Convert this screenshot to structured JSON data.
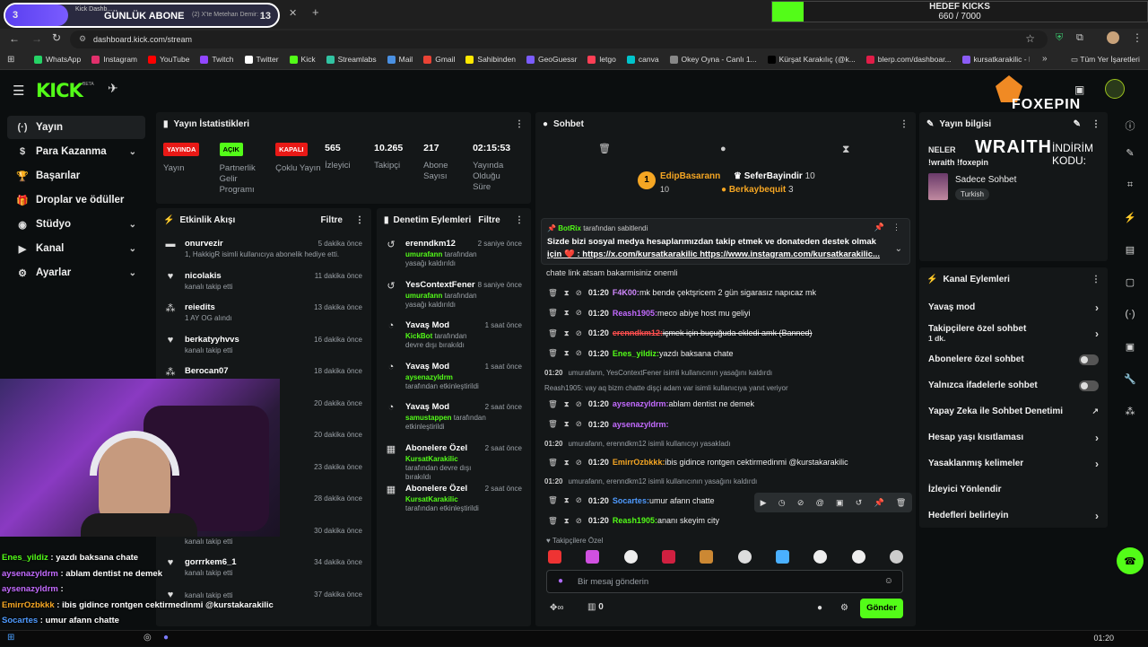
{
  "overlay": {
    "sub_goal_count": "3",
    "sub_goal_label": "GÜNLÜK ABONE",
    "sub_goal_target": "13",
    "kicks_goal_label": "HEDEF KICKS",
    "kicks_goal_value": "660 / 7000",
    "brand": "FOXEPIN",
    "promo_text": "WRAITH",
    "promo_code_label": "İNDİRİM KODU:",
    "promo_code_value": "!wraith !foxepin"
  },
  "browser": {
    "tabs": [
      {
        "label": "Kick Dashb..."
      },
      {
        "label": "(2) X'te Metehan Demir: ..."
      }
    ],
    "url": "dashboard.kick.com/stream",
    "bookmarks": [
      {
        "label": "WhatsApp",
        "color": "#25d366"
      },
      {
        "label": "Instagram",
        "color": "#e1306c"
      },
      {
        "label": "YouTube",
        "color": "#ff0000"
      },
      {
        "label": "Twitch",
        "color": "#9146ff"
      },
      {
        "label": "Twitter",
        "color": "#ffffff"
      },
      {
        "label": "Kick",
        "color": "#53fc18"
      },
      {
        "label": "Streamlabs",
        "color": "#31c3a2"
      },
      {
        "label": "Mail",
        "color": "#4a90e2"
      },
      {
        "label": "Gmail",
        "color": "#ea4335"
      },
      {
        "label": "Sahibinden",
        "color": "#ffe800"
      },
      {
        "label": "GeoGuessr",
        "color": "#7b5cff"
      },
      {
        "label": "letgo",
        "color": "#ff3f55"
      },
      {
        "label": "canva",
        "color": "#00c4cc"
      },
      {
        "label": "Okey Oyna - Canlı 1...",
        "color": "#888888"
      },
      {
        "label": "Kürşat Karakılıç (@k...",
        "color": "#000000"
      },
      {
        "label": "blerp.com/dashboar...",
        "color": "#e11d48"
      },
      {
        "label": "kursatkarakilic - Kic...",
        "color": "#8b5cf6"
      }
    ],
    "all_bookmarks": "Tüm Yer İşaretleri"
  },
  "nav": {
    "items": [
      {
        "label": "Yayın",
        "icon": "(·)",
        "chev": ""
      },
      {
        "label": "Para Kazanma",
        "icon": "$",
        "chev": "⌄"
      },
      {
        "label": "Başarılar",
        "icon": "🏆",
        "chev": ""
      },
      {
        "label": "Droplar ve ödüller",
        "icon": "🎁",
        "chev": ""
      },
      {
        "label": "Stüdyo",
        "icon": "◉",
        "chev": "⌄"
      },
      {
        "label": "Kanal",
        "icon": "▶",
        "chev": "⌄"
      },
      {
        "label": "Ayarlar",
        "icon": "⚙",
        "chev": "⌄"
      }
    ]
  },
  "stats": {
    "title": "Yayın İstatistikleri",
    "items": [
      {
        "badge": "YAYINDA",
        "badge_color": "#e91916",
        "label": "Yayın"
      },
      {
        "badge": "AÇIK",
        "badge_color": "#53fc18",
        "label": "Partnerlik Gelir Programı"
      },
      {
        "badge": "KAPALI",
        "badge_color": "#e91916",
        "label": "Çoklu Yayın"
      },
      {
        "value": "565",
        "label": "İzleyici"
      },
      {
        "value": "10.265",
        "label": "Takipçi"
      },
      {
        "value": "217",
        "label": "Abone Sayısı"
      },
      {
        "value": "02:15:53",
        "label": "Yayında Olduğu Süre"
      }
    ]
  },
  "activity": {
    "title": "Etkinlik Akışı",
    "filter": "Filtre",
    "items": [
      {
        "name": "onurvezir",
        "sub": "1, HakkigR isimli kullanıcıya abonelik hediye etti.",
        "time": "5 dakika önce",
        "icon": "▬"
      },
      {
        "name": "nicolakis",
        "sub": "kanalı takip etti",
        "time": "11 dakika önce",
        "icon": "♥"
      },
      {
        "name": "reiedits",
        "sub": "1 AY OG alındı",
        "time": "13 dakika önce",
        "icon": "⁂"
      },
      {
        "name": "berkatyyhvvs",
        "sub": "kanalı takip etti",
        "time": "16 dakika önce",
        "icon": "♥"
      },
      {
        "name": "Berocan07",
        "sub": "",
        "time": "18 dakika önce",
        "icon": "⁂"
      },
      {
        "name": "",
        "sub": "",
        "time": "20 dakika önce",
        "icon": ""
      },
      {
        "name": "",
        "sub": "",
        "time": "20 dakika önce",
        "icon": ""
      },
      {
        "name": "n abone",
        "sub": "",
        "time": "23 dakika önce",
        "icon": ""
      },
      {
        "name": "",
        "sub": "",
        "time": "28 dakika önce",
        "icon": ""
      },
      {
        "name": "Mereaxia",
        "sub": "kanalı takip etti",
        "time": "30 dakika önce",
        "icon": "♥"
      },
      {
        "name": "gorrrkem6_1",
        "sub": "kanalı takip etti",
        "time": "34 dakika önce",
        "icon": "♥"
      },
      {
        "name": "",
        "sub": "kanalı takip etti",
        "time": "37 dakika önce",
        "icon": "♥"
      }
    ]
  },
  "moderation": {
    "title": "Denetim Eylemleri",
    "filter": "Filtre",
    "items": [
      {
        "name": "erenndkm12",
        "user": "umurafann",
        "sub": " tarafından yasağı kaldırıldı",
        "time": "2 saniye önce",
        "icon": "↺"
      },
      {
        "name": "YesContextFener",
        "user": "umurafann",
        "sub": " tarafından yasağı kaldırıldı",
        "time": "8 saniye önce",
        "icon": "↺"
      },
      {
        "name": "Yavaş Mod",
        "user": "KickBot",
        "sub": " tarafından devre dışı bırakıldı",
        "time": "1 saat önce",
        "icon": "◔"
      },
      {
        "name": "Yavaş Mod",
        "user": "aysenazyldrm",
        "sub": " tarafından etkinleştirildi",
        "time": "1 saat önce",
        "icon": "◔"
      },
      {
        "name": "Yavaş Mod",
        "user": "samustappen",
        "sub": " tarafından etkinleştirildi",
        "time": "2 saat önce",
        "icon": "◔"
      },
      {
        "name": "Abonelere Özel",
        "user": "KursatKarakilic",
        "sub": " tarafından devre dışı bırakıldı",
        "time": "2 saat önce",
        "icon": "▦"
      },
      {
        "name": "Abonelere Özel",
        "user": "KursatKarakilic",
        "sub": " tarafından etkinleştirildi",
        "time": "2 saat önce",
        "icon": "▦"
      }
    ]
  },
  "chat": {
    "title": "Sohbet",
    "leaderboard": [
      {
        "rank": "1",
        "name": "EdipBasarann",
        "count": "10",
        "color": "#f5a623"
      },
      {
        "name": "SeferBayindir",
        "count": "10"
      },
      {
        "name": "Berkaybequit",
        "count": "3",
        "color": "#f5a623"
      }
    ],
    "pinned_by_user": "BotRix",
    "pinned_by_text": " tarafından sabitlendi",
    "pinned_text_1": "Sizde bizi sosyal medya hesaplarımızdan takip etmek ve donateden destek olmak",
    "pinned_text_2": "için ❤️ : https://x.com/kursatkarakilic https://www.instagram.com/kursatkarakilic...",
    "cut_line": "chate link atsam bakarmisiniz onemli",
    "messages": [
      {
        "time": "01:20",
        "user": "F4K00:",
        "color": "#d28aff",
        "text": " mk bende çektşricem 2 gün sigarasız napıcaz mk"
      },
      {
        "time": "01:20",
        "user": "Reash1905:",
        "color": "#c36bff",
        "text": " meco abiye host mu geliyi"
      },
      {
        "time": "01:20",
        "user": "erenndkm12:",
        "color": "#ff4f4f",
        "text": " içmek için buçuğuda ekledi amk (Banned)"
      },
      {
        "time": "01:20",
        "user": "Enes_yildiz:",
        "color": "#53fc18",
        "text": " yazdı baksana chate"
      },
      {
        "sys": "01:20",
        "text": "umurafann, YesContextFener isimli kullanıcının yasağını kaldırdı"
      },
      {
        "reply": "Reash1905: vay aq bizm chatte dişçi adam var isimli kullanıcıya yanıt veriyor"
      },
      {
        "time": "01:20",
        "user": "aysenazyldrm:",
        "color": "#c36bff",
        "text": " ablam dentist ne demek"
      },
      {
        "time": "01:20",
        "user": "aysenazyldrm:",
        "color": "#c36bff",
        "text": " "
      },
      {
        "sys": "01:20",
        "text": "umurafann, erenndkm12 isimli kullanıcıyı yasakladı"
      },
      {
        "time": "01:20",
        "user": "EmirrOzbkkk:",
        "color": "#f5a623",
        "text": " ibis gidince rontgen cektirmedinmi @kurstakarakilic"
      },
      {
        "sys": "01:20",
        "text": "umurafann, erenndkm12 isimli kullanıcının yasağını kaldırdı"
      },
      {
        "time": "01:20",
        "user": "Socartes:",
        "color": "#4f9bff",
        "text": " umur afann chatte"
      },
      {
        "time": "01:20",
        "user": "Reash1905:",
        "color": "#53fc18",
        "text": " ananı skeyim city"
      }
    ],
    "followers_only": "Takipçilere Özel",
    "input_placeholder": "Bir mesaj gönderin",
    "send_label": "Gönder",
    "gift_count": "0"
  },
  "stream_info": {
    "title": "Yayın bilgisi",
    "title_text_1": "NELER",
    "title_text_2": "!wraith !foxepin",
    "category": "Sadece Sohbet",
    "tag": "Turkish"
  },
  "channel_actions": {
    "title": "Kanal Eylemleri",
    "items": [
      {
        "label": "Yavaş mod",
        "type": "chev"
      },
      {
        "label": "Takipçilere özel sohbet",
        "sub": "1 dk.",
        "type": "chev"
      },
      {
        "label": "Abonelere özel sohbet",
        "type": "toggle"
      },
      {
        "label": "Yalnızca ifadelerle sohbet",
        "type": "toggle"
      },
      {
        "label": "Yapay Zeka ile Sohbet Denetimi",
        "type": "ext"
      },
      {
        "label": "Hesap yaşı kısıtlaması",
        "type": "chev"
      },
      {
        "label": "Yasaklanmış kelimeler",
        "type": "chev"
      },
      {
        "label": "İzleyici Yönlendir",
        "type": "none"
      },
      {
        "label": "Hedefleri belirleyin",
        "type": "chev"
      }
    ]
  },
  "overlay_chat": [
    {
      "user": "Enes_yildiz",
      "color": "#53fc18",
      "text": " : yazdı baksana chate"
    },
    {
      "user": "aysenazyldrm",
      "color": "#c36bff",
      "text": " : ablam dentist ne demek"
    },
    {
      "user": "aysenazyldrm",
      "color": "#c36bff",
      "text": " : "
    },
    {
      "user": "EmirrOzbkkk",
      "color": "#f5a623",
      "text": " : ibis gidince rontgen cektirmedinmi @kurstakarakilic"
    },
    {
      "user": "Socartes",
      "color": "#4f9bff",
      "text": " : umur afann chatte"
    },
    {
      "user": "Reash1905",
      "color": "#53fc18",
      "text": " : ananı skeyim city"
    }
  ],
  "taskbar": {
    "time": "01:20"
  }
}
